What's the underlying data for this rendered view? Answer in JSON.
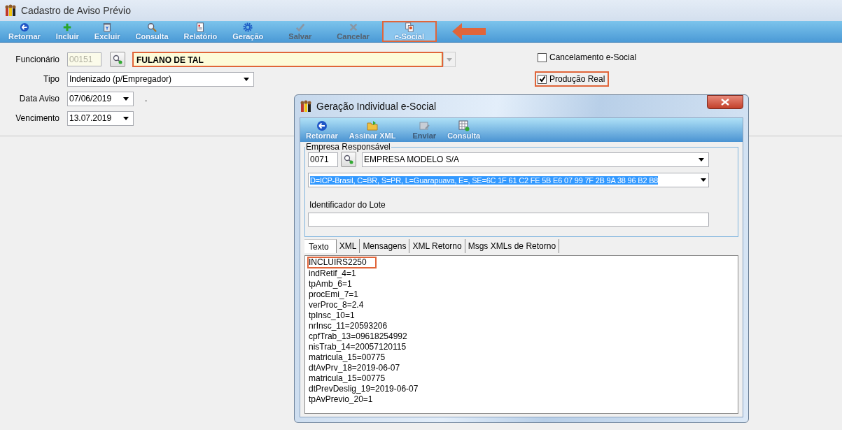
{
  "window": {
    "title": "Cadastro de Aviso Prévio"
  },
  "toolbar": [
    {
      "label": "Retornar",
      "kind": "back",
      "disabled": false,
      "highlighted": false
    },
    {
      "label": "Incluir",
      "kind": "add",
      "disabled": false,
      "highlighted": false
    },
    {
      "label": "Excluir",
      "kind": "delete",
      "disabled": false,
      "highlighted": false
    },
    {
      "label": "Consulta",
      "kind": "query",
      "disabled": false,
      "highlighted": false
    },
    {
      "label": "Relatório",
      "kind": "report",
      "disabled": false,
      "highlighted": false
    },
    {
      "label": "Geração",
      "kind": "generate",
      "disabled": false,
      "highlighted": false
    },
    {
      "label": "Salvar",
      "kind": "save",
      "disabled": true,
      "highlighted": false
    },
    {
      "label": "Cancelar",
      "kind": "cancel",
      "disabled": true,
      "highlighted": false
    },
    {
      "label": "e-Social",
      "kind": "esocial",
      "disabled": false,
      "highlighted": true
    }
  ],
  "form": {
    "funcionario": {
      "label": "Funcionário",
      "code": "00151",
      "name": "FULANO DE TAL",
      "highlighted": true
    },
    "tipo": {
      "label": "Tipo",
      "value": "Indenizado (p/Empregador)"
    },
    "data_aviso": {
      "label": "Data Aviso",
      "value": "07/06/2019",
      "note": "."
    },
    "vencimento": {
      "label": "Vencimento",
      "value": "13.07.2019"
    }
  },
  "checkboxes": [
    {
      "label": "Cancelamento e-Social",
      "checked": false,
      "highlighted": false
    },
    {
      "label": "Produção Real",
      "checked": true,
      "highlighted": true
    }
  ],
  "dialog": {
    "title": "Geração Individual e-Social",
    "toolbar": [
      {
        "label": "Retornar",
        "kind": "back",
        "disabled": false
      },
      {
        "label": "Assinar XML",
        "kind": "sign",
        "disabled": false
      },
      {
        "label": "Enviar",
        "kind": "send",
        "disabled": true
      },
      {
        "label": "Consulta",
        "kind": "query",
        "disabled": false
      }
    ],
    "group": {
      "title": "Empresa Responsável",
      "code": "0071",
      "company": "EMPRESA MODELO S/A",
      "certificate": "D=ICP-Brasil, C=BR, S=PR, L=Guarapuava, E=, SE=6C 1F 61 C2 FE 5B E6 07 99 7F 2B 9A 38 96 B2 B8",
      "lote_label": "Identificador do Lote"
    },
    "tabs": [
      {
        "label": "Texto",
        "selected": true
      },
      {
        "label": "XML",
        "selected": false
      },
      {
        "label": "Mensagens",
        "selected": false
      },
      {
        "label": "XML Retorno",
        "selected": false
      },
      {
        "label": "Msgs XMLs de Retorno",
        "selected": false
      }
    ],
    "text_lines": [
      {
        "text": "INCLUIRS2250",
        "highlighted": true
      },
      {
        "text": "indRetif_4=1",
        "highlighted": false
      },
      {
        "text": "tpAmb_6=1",
        "highlighted": false
      },
      {
        "text": "procEmi_7=1",
        "highlighted": false
      },
      {
        "text": "verProc_8=2.4",
        "highlighted": false
      },
      {
        "text": "tpInsc_10=1",
        "highlighted": false
      },
      {
        "text": "nrInsc_11=20593206",
        "highlighted": false
      },
      {
        "text": "cpfTrab_13=09618254992",
        "highlighted": false
      },
      {
        "text": "nisTrab_14=20057120115",
        "highlighted": false
      },
      {
        "text": "matricula_15=00775",
        "highlighted": false
      },
      {
        "text": "dtAvPrv_18=2019-06-07",
        "highlighted": false
      },
      {
        "text": "matricula_15=00775",
        "highlighted": false
      },
      {
        "text": "dtPrevDeslig_19=2019-06-07",
        "highlighted": false
      },
      {
        "text": "tpAvPrevio_20=1",
        "highlighted": false
      }
    ]
  }
}
